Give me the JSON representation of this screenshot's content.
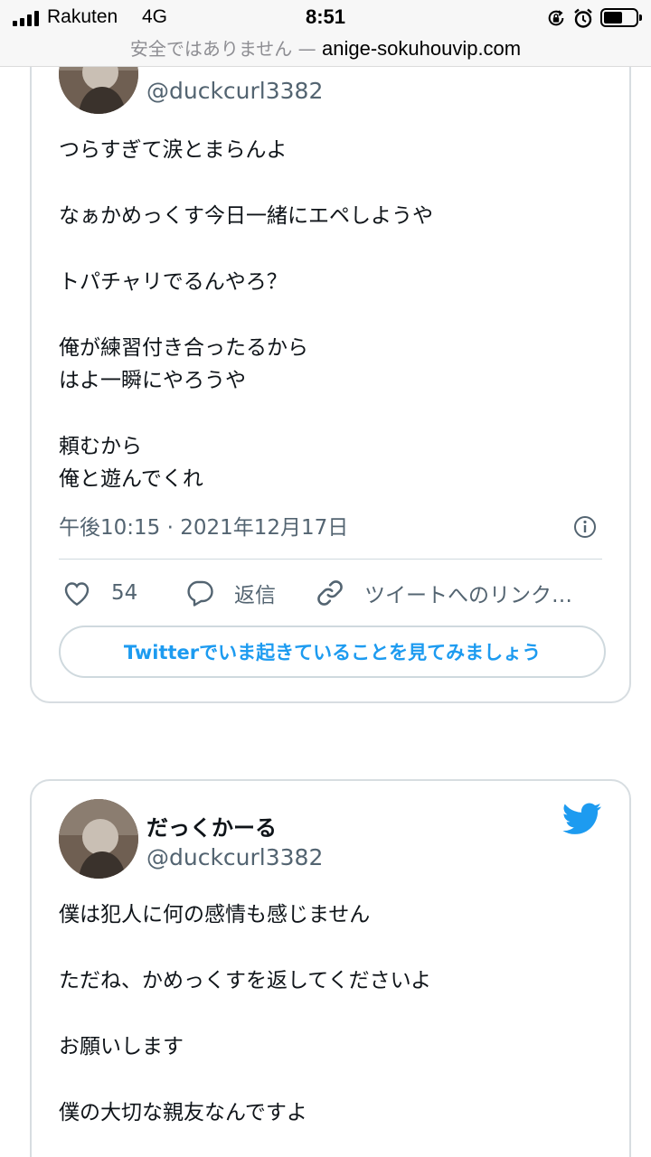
{
  "status_bar": {
    "carrier": "Rakuten",
    "network": "4G",
    "time": "8:51"
  },
  "address_bar": {
    "security_label": "安全ではありません",
    "separator": "—",
    "host": "anige-sokuhouvip.com"
  },
  "colors": {
    "twitter_blue": "#1d9bf0",
    "secondary_text": "#536471",
    "card_border": "#d7dde1"
  },
  "tweets": [
    {
      "handle": "@duckcurl3382",
      "lines": [
        "つらすぎて涙とまらんよ",
        "",
        "なぁかめっくす今日一緒にエペしようや",
        "",
        "トパチャリでるんやろ？",
        "",
        "俺が練習付き合ったるから",
        "はよ一瞬にやろうや",
        "",
        "頼むから",
        "俺と遊んでくれ"
      ],
      "timestamp": "午後10:15 · 2021年12月17日",
      "likes": "54",
      "reply_label": "返信",
      "link_label": "ツイートへのリンク…",
      "cta": "Twitterでいま起きていることを見てみましょう"
    },
    {
      "name": "だっくかーる",
      "handle": "@duckcurl3382",
      "lines": [
        "僕は犯人に何の感情も感じません",
        "",
        "ただね、かめっくすを返してくださいよ",
        "",
        "お願いします",
        "",
        "僕の大切な親友なんですよ"
      ]
    }
  ],
  "icons": [
    "lock-rotation-icon",
    "alarm-icon",
    "battery-icon",
    "heart-icon",
    "reply-bubble-icon",
    "link-icon",
    "info-icon",
    "twitter-bird-icon"
  ]
}
